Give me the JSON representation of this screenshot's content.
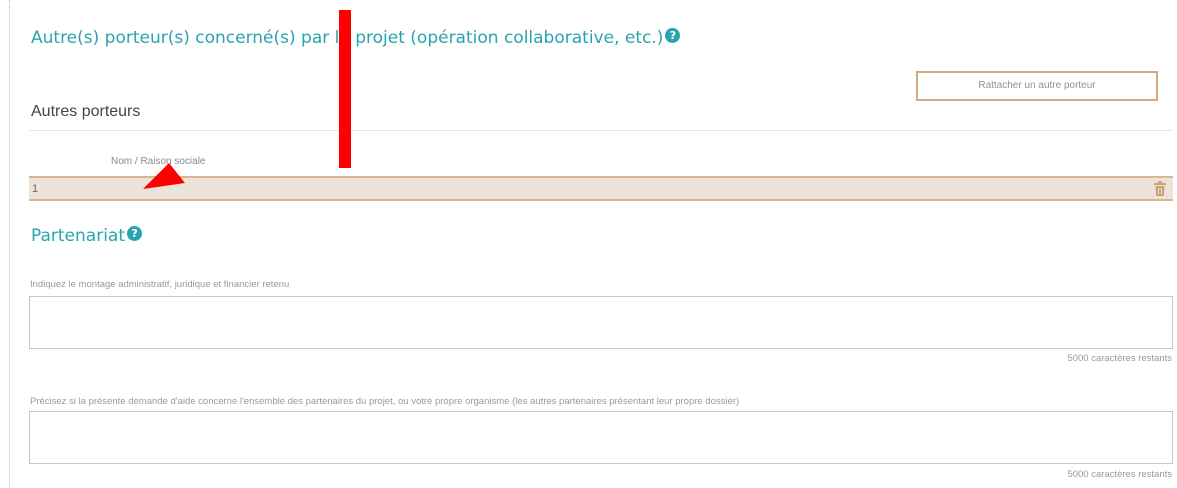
{
  "section_porteurs": {
    "title": "Autre(s) porteur(s) concerné(s) par le projet (opération collaborative, etc.)",
    "help_icon": "question-circle-icon"
  },
  "attach_button_label": "Rattacher un autre porteur",
  "subsection_title": "Autres porteurs",
  "table": {
    "column_header": "Nom / Raison sociale",
    "rows": [
      {
        "number": "1",
        "delete_icon": "trash-icon"
      }
    ]
  },
  "section_partenariat": {
    "title": "Partenariat",
    "help_icon": "question-circle-icon"
  },
  "fields": [
    {
      "label": "Indiquez le montage administratif, juridique et financier retenu",
      "value": "",
      "counter": "5000 caractères restants"
    },
    {
      "label": "Précisez si la présente demande d'aide concerne l'ensemble des partenaires du projet, ou votre propre organisme (les autres partenaires présentant leur propre dossier)",
      "value": "",
      "counter": "5000 caractères restants"
    }
  ],
  "colors": {
    "accent": "#2aa3b1",
    "row_border": "#d9b587",
    "row_bg": "#ece3da",
    "annotation": "#ff0000"
  }
}
